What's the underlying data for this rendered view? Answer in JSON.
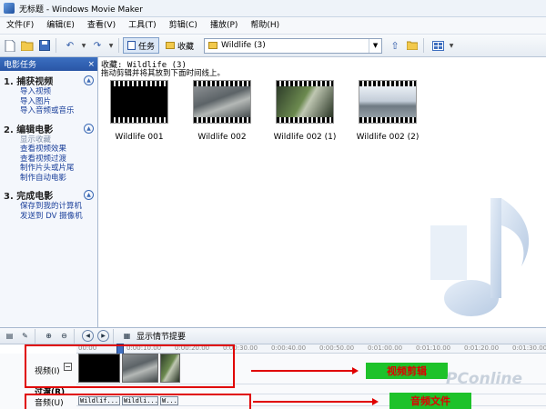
{
  "window": {
    "title": "无标题 - Windows Movie Maker"
  },
  "menu": [
    "文件(F)",
    "编辑(E)",
    "查看(V)",
    "工具(T)",
    "剪辑(C)",
    "播放(P)",
    "帮助(H)"
  ],
  "toolbar": {
    "tasks_label": "任务",
    "collections_label": "收藏",
    "collection_value": "Wildlife (3)"
  },
  "sidepanel": {
    "header": "电影任务",
    "close": "×",
    "sections": [
      {
        "title": "1. 捕获视频",
        "links": [
          "导入视频",
          "导入图片",
          "导入音频或音乐"
        ]
      },
      {
        "title": "2. 编辑电影",
        "links": [
          "显示收藏",
          "查看视频效果",
          "查看视频过渡",
          "制作片头或片尾",
          "制作自动电影"
        ]
      },
      {
        "title": "3. 完成电影",
        "links": [
          "保存到我的计算机",
          "发送到 DV 摄像机"
        ]
      }
    ]
  },
  "content": {
    "collection_title": "收藏: Wildlife (3)",
    "hint": "拖动剪辑并将其放到下面时间线上。",
    "clips": [
      "Wildlife 001",
      "Wildlife 002",
      "Wildlife 002 (1)",
      "Wildlife 002 (2)"
    ]
  },
  "timeline": {
    "storyboard_label": "显示情节提要",
    "ruler": [
      "00:00",
      "0:00:10.00",
      "0:00:20.00",
      "0:00:30.00",
      "0:00:40.00",
      "0:00:50.00",
      "0:01:00.00",
      "0:01:10.00",
      "0:01:20.00",
      "0:01:30.00"
    ],
    "video_label": "视频(I)",
    "transition_label": "过渡(R)",
    "audio_label": "音频(U)",
    "audio_clips": [
      "Wildlif...",
      "Wildli...",
      "W..."
    ]
  },
  "annotations": {
    "video_edit": "视频剪辑",
    "audio_file": "音频文件"
  },
  "watermark": {
    "logo": "PConline"
  },
  "colors": {
    "accent": "#2a56a6",
    "annotation_red": "#e00000",
    "tag_green": "#1ec22a"
  }
}
